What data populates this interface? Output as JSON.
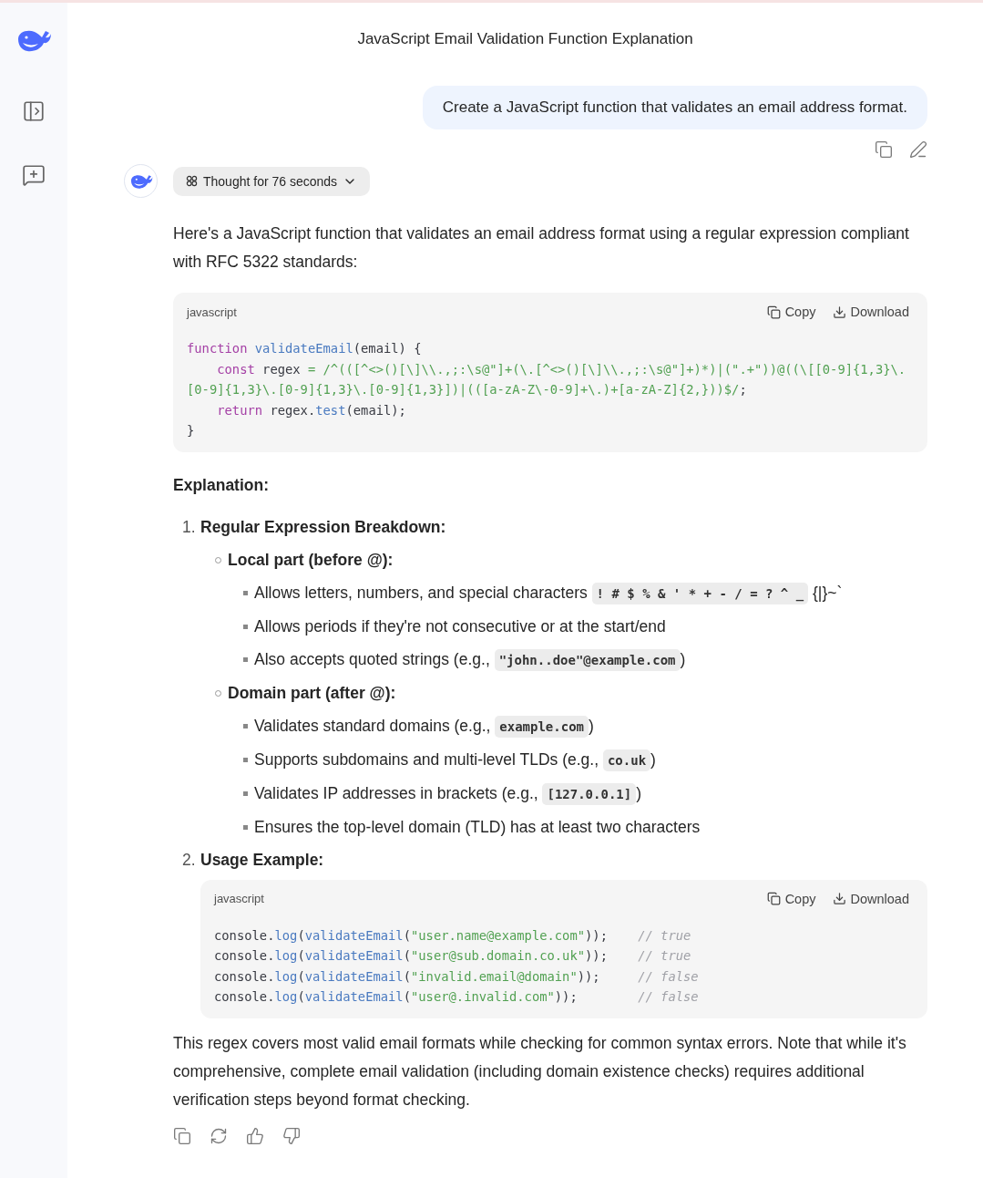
{
  "title": "JavaScript Email Validation Function Explanation",
  "user_message": {
    "text": "Create a JavaScript function that validates an email address format."
  },
  "thought": {
    "label": "Thought for 76 seconds",
    "expanded": false
  },
  "blocks": [
    {
      "kind": "paragraph",
      "text": "Here's a JavaScript function that validates an email address format using a regular expression compliant with RFC 5322 standards:"
    },
    {
      "kind": "code",
      "language": "javascript",
      "copy": "Copy",
      "download": "Download",
      "lines": [
        [
          {
            "kind": "keyword",
            "text": "function"
          },
          {
            "kind": "function",
            "text": " validateEmail"
          },
          {
            "kind": "plain",
            "text": "(email) {"
          }
        ],
        [
          {
            "kind": "keyword",
            "text": "    const"
          },
          {
            "kind": "plain",
            "text": " regex "
          },
          {
            "kind": "string",
            "text": "= /^(([^<>()[\\]\\\\.,;:\\s@\"]+(\\.[^<>()[\\]\\\\.,;:\\s@\"]+)*)|(\".+\"))@((\\[[0-9]{1,3}\\.[0-9]{1,3}\\.[0-9]{1,3}\\.[0-9]{1,3}])|(([a-zA-Z\\-0-9]+\\.)+[a-zA-Z]{2,}))$/"
          },
          {
            "kind": "plain",
            "text": ";"
          }
        ],
        [
          {
            "kind": "keyword",
            "text": "    return"
          },
          {
            "kind": "plain",
            "text": " regex."
          },
          {
            "kind": "function",
            "text": "test"
          },
          {
            "kind": "plain",
            "text": "(email);"
          }
        ],
        [
          {
            "kind": "plain",
            "text": "}"
          }
        ]
      ]
    },
    {
      "kind": "heading",
      "text": "Explanation:"
    },
    {
      "kind": "ordered_list",
      "items": [
        {
          "marker": "1.",
          "title": "Regular Expression Breakdown:",
          "children": [
            {
              "title": "Local part (before @):",
              "children": [
                {
                  "parts": [
                    {
                      "kind": "text",
                      "text": "Allows letters, numbers, and special characters "
                    },
                    {
                      "kind": "code",
                      "text": "! # $ % & ' * + - / = ? ^ _"
                    },
                    {
                      "kind": "text",
                      "text": " {|}~`"
                    }
                  ]
                },
                {
                  "parts": [
                    {
                      "kind": "text",
                      "text": "Allows periods if they're not consecutive or at the start/end"
                    }
                  ]
                },
                {
                  "parts": [
                    {
                      "kind": "text",
                      "text": "Also accepts quoted strings (e.g., "
                    },
                    {
                      "kind": "code",
                      "text": "\"john..doe\"@example.com"
                    },
                    {
                      "kind": "text",
                      "text": ")"
                    }
                  ]
                }
              ]
            },
            {
              "title": "Domain part (after @):",
              "children": [
                {
                  "parts": [
                    {
                      "kind": "text",
                      "text": "Validates standard domains (e.g., "
                    },
                    {
                      "kind": "code",
                      "text": "example.com"
                    },
                    {
                      "kind": "text",
                      "text": ")"
                    }
                  ]
                },
                {
                  "parts": [
                    {
                      "kind": "text",
                      "text": "Supports subdomains and multi-level TLDs (e.g., "
                    },
                    {
                      "kind": "code",
                      "text": "co.uk"
                    },
                    {
                      "kind": "text",
                      "text": ")"
                    }
                  ]
                },
                {
                  "parts": [
                    {
                      "kind": "text",
                      "text": "Validates IP addresses in brackets (e.g., "
                    },
                    {
                      "kind": "code",
                      "text": "[127.0.0.1]"
                    },
                    {
                      "kind": "text",
                      "text": ")"
                    }
                  ]
                },
                {
                  "parts": [
                    {
                      "kind": "text",
                      "text": "Ensures the top-level domain (TLD) has at least two characters"
                    }
                  ]
                }
              ]
            }
          ]
        },
        {
          "marker": "2.",
          "title": "Usage Example:",
          "code": {
            "language": "javascript",
            "copy": "Copy",
            "download": "Download",
            "lines": [
              [
                {
                  "kind": "plain",
                  "text": "console."
                },
                {
                  "kind": "function",
                  "text": "log"
                },
                {
                  "kind": "plain",
                  "text": "("
                },
                {
                  "kind": "function",
                  "text": "validateEmail"
                },
                {
                  "kind": "plain",
                  "text": "("
                },
                {
                  "kind": "string",
                  "text": "\"user.name@example.com\""
                },
                {
                  "kind": "plain",
                  "text": "));"
                },
                {
                  "kind": "comment",
                  "text": "    // true"
                }
              ],
              [
                {
                  "kind": "plain",
                  "text": "console."
                },
                {
                  "kind": "function",
                  "text": "log"
                },
                {
                  "kind": "plain",
                  "text": "("
                },
                {
                  "kind": "function",
                  "text": "validateEmail"
                },
                {
                  "kind": "plain",
                  "text": "("
                },
                {
                  "kind": "string",
                  "text": "\"user@sub.domain.co.uk\""
                },
                {
                  "kind": "plain",
                  "text": "));"
                },
                {
                  "kind": "comment",
                  "text": "    // true"
                }
              ],
              [
                {
                  "kind": "plain",
                  "text": "console."
                },
                {
                  "kind": "function",
                  "text": "log"
                },
                {
                  "kind": "plain",
                  "text": "("
                },
                {
                  "kind": "function",
                  "text": "validateEmail"
                },
                {
                  "kind": "plain",
                  "text": "("
                },
                {
                  "kind": "string",
                  "text": "\"invalid.email@domain\""
                },
                {
                  "kind": "plain",
                  "text": "));"
                },
                {
                  "kind": "comment",
                  "text": "     // false"
                }
              ],
              [
                {
                  "kind": "plain",
                  "text": "console."
                },
                {
                  "kind": "function",
                  "text": "log"
                },
                {
                  "kind": "plain",
                  "text": "("
                },
                {
                  "kind": "function",
                  "text": "validateEmail"
                },
                {
                  "kind": "plain",
                  "text": "("
                },
                {
                  "kind": "string",
                  "text": "\"user@.invalid.com\""
                },
                {
                  "kind": "plain",
                  "text": "));"
                },
                {
                  "kind": "comment",
                  "text": "        // false"
                }
              ]
            ]
          }
        }
      ]
    },
    {
      "kind": "paragraph",
      "text": "This regex covers most valid email formats while checking for common syntax errors. Note that while it's comprehensive, complete email validation (including domain existence checks) requires additional verification steps beyond format checking."
    }
  ]
}
